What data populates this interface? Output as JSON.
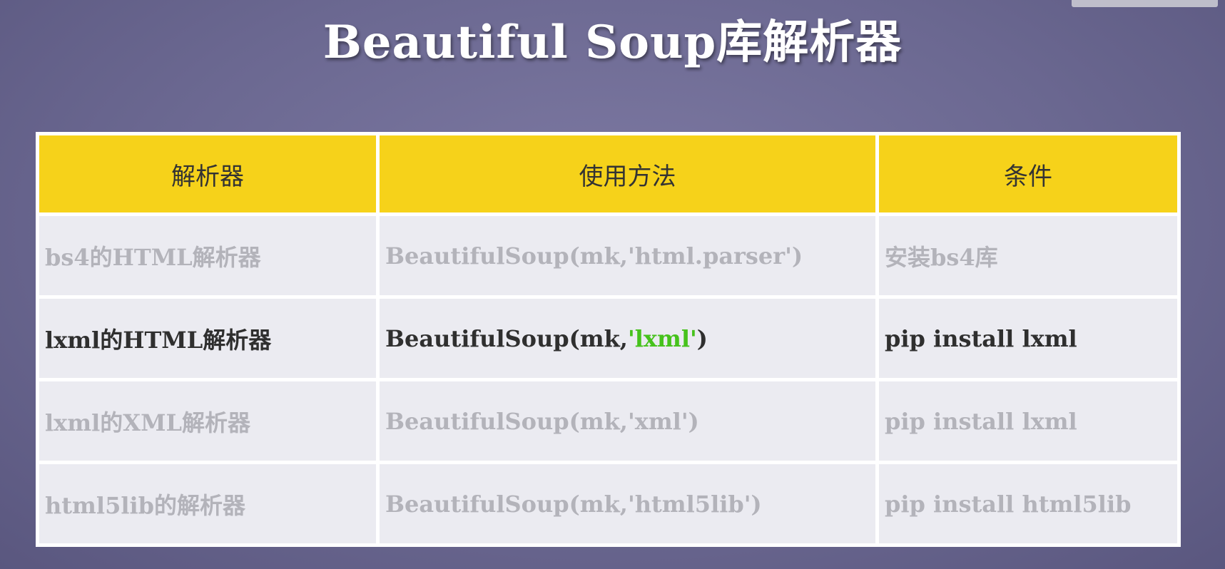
{
  "title": "Beautiful Soup库解析器",
  "table": {
    "headers": [
      "解析器",
      "使用方法",
      "条件"
    ],
    "rows": [
      {
        "parser": "bs4的HTML解析器",
        "method": {
          "before": "BeautifulSoup(mk,",
          "arg": "'html.parser'",
          "after": ")"
        },
        "condition": "安装bs4库",
        "highlighted": false
      },
      {
        "parser": "lxml的HTML解析器",
        "method": {
          "before": "BeautifulSoup(mk,",
          "arg": "'lxml'",
          "after": ")"
        },
        "condition": "pip install lxml",
        "highlighted": true
      },
      {
        "parser": "lxml的XML解析器",
        "method": {
          "before": "BeautifulSoup(mk,",
          "arg": "'xml'",
          "after": ")"
        },
        "condition": "pip install lxml",
        "highlighted": false
      },
      {
        "parser": "html5lib的解析器",
        "method": {
          "before": "BeautifulSoup(mk,",
          "arg": "'html5lib'",
          "after": ")"
        },
        "condition": "pip install html5lib",
        "highlighted": false
      }
    ]
  },
  "colors": {
    "header_bg": "#f6d21a",
    "cell_bg": "#ebebf1",
    "faded_text": "#b3b3ba",
    "highlight_text": "#2f2f2f",
    "highlight_arg": "#46c21c",
    "background": "#6b6891"
  }
}
